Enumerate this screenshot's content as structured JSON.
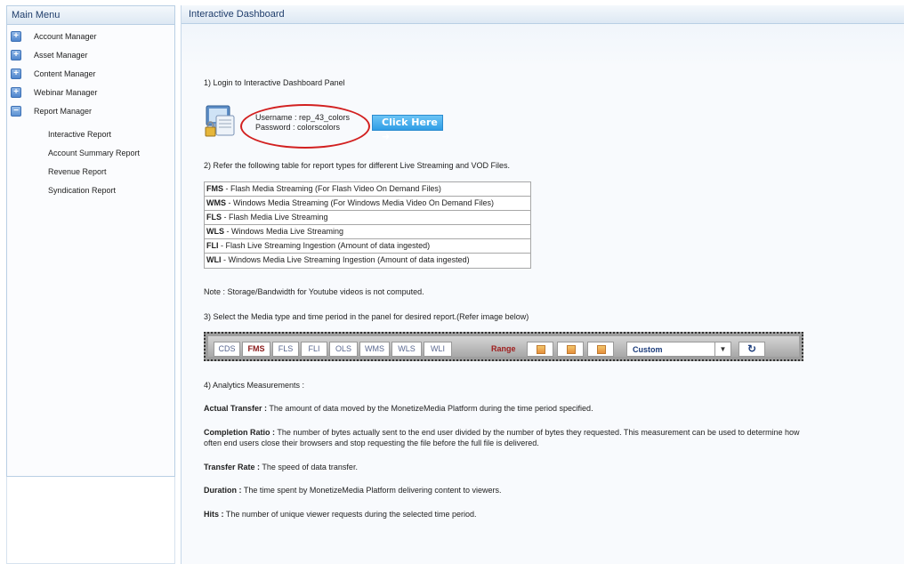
{
  "sidebar": {
    "title": "Main Menu",
    "items": [
      {
        "label": "Account Manager",
        "icon": "+"
      },
      {
        "label": "Asset Manager",
        "icon": "+"
      },
      {
        "label": "Content Manager",
        "icon": "+"
      },
      {
        "label": "Webinar Manager",
        "icon": "+"
      },
      {
        "label": "Report Manager",
        "icon": "−"
      }
    ],
    "submenu": [
      {
        "label": "Interactive Report"
      },
      {
        "label": "Account Summary Report"
      },
      {
        "label": "Revenue Report"
      },
      {
        "label": "Syndication Report"
      }
    ]
  },
  "main": {
    "title": "Interactive Dashboard",
    "step1": "1) Login to Interactive Dashboard Panel",
    "username": "Username : rep_43_colors",
    "password": "Password : colorscolors",
    "click_button": "Click Here ➜",
    "step2": "2) Refer the following table for report types for different Live Streaming and VOD Files.",
    "types": [
      {
        "code": "FMS",
        "desc": " - Flash Media Streaming (For Flash Video On Demand Files)"
      },
      {
        "code": "WMS",
        "desc": " - Windows Media Streaming (For Windows Media Video On Demand Files)"
      },
      {
        "code": "FLS",
        "desc": " - Flash Media Live Streaming"
      },
      {
        "code": "WLS",
        "desc": " - Windows Media Live Streaming"
      },
      {
        "code": "FLI",
        "desc": " - Flash Live Streaming Ingestion (Amount of data ingested)"
      },
      {
        "code": "WLI",
        "desc": " - Windows Media Live Streaming Ingestion (Amount of data ingested)"
      }
    ],
    "note": "Note : Storage/Bandwidth for Youtube videos is not computed.",
    "step3": "3) Select the Media type and time period in the panel for desired report.(Refer image below)",
    "media_tabs": [
      "CDS",
      "FMS",
      "FLS",
      "FLI",
      "OLS",
      "WMS",
      "WLS",
      "WLI"
    ],
    "media_active": "FMS",
    "range_label": "Range",
    "range_select": "Custom",
    "refresh_icon": "↻",
    "step4": "4) Analytics Measurements :",
    "measurements": [
      {
        "term": "Actual Transfer :",
        "text": " The amount of data moved by the MonetizeMedia Platform during the time period specified."
      },
      {
        "term": "Completion Ratio :",
        "text": " The number of bytes actually sent to the end user divided by the number of bytes they requested. This measurement can be used to determine how",
        "text2": "often end users close their browsers and stop requesting the file before the full file is delivered."
      },
      {
        "term": "Transfer Rate :",
        "text": " The speed of data transfer."
      },
      {
        "term": "Duration :",
        "text": " The time spent by MonetizeMedia Platform delivering content to viewers."
      },
      {
        "term": "Hits :",
        "text": " The number of unique viewer requests during the selected time period."
      }
    ]
  }
}
